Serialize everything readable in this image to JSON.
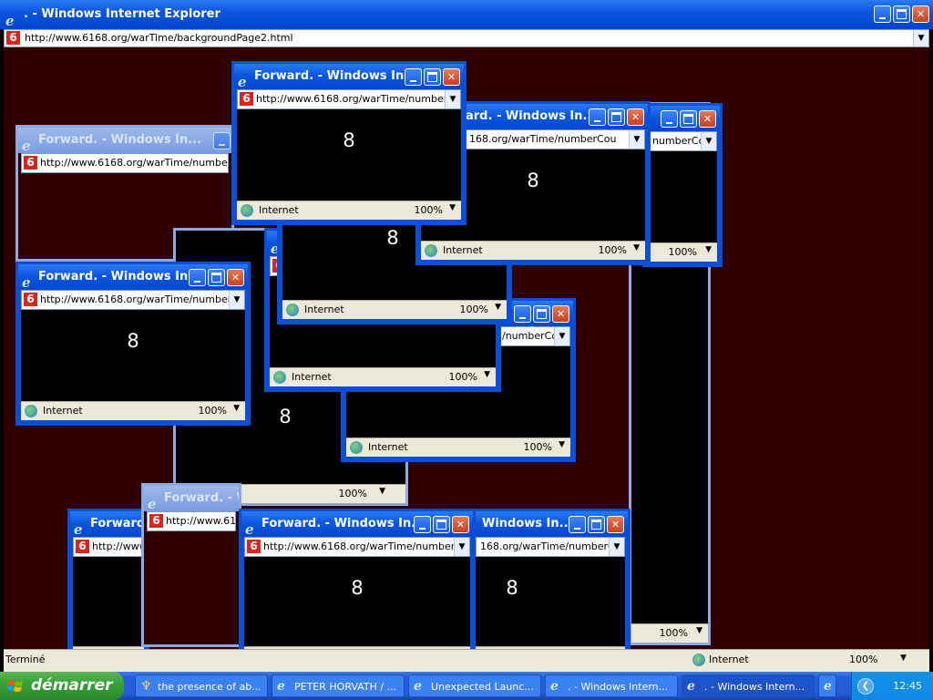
{
  "main": {
    "title": ". - Windows Internet Explorer",
    "address": "http://www.6168.org/warTime/backgroundPage2.html",
    "status": "Terminé",
    "zone": "Internet",
    "zoom": "100%"
  },
  "popup": {
    "title": "Forward. - Windows In...",
    "title_tail": "Windows In...",
    "title_frag": "Forward. - W",
    "title_frag2": "Forward.",
    "title_frag3": "ard. - Windows In...",
    "address": "http://www.6168.org/warTime/numberCou",
    "address_frag": "http://www",
    "address_frag2": "http://www.61",
    "address_frag3": "168.org/warTime/numberCou",
    "address_frag4": "numberCou",
    "address_frag5": "/numberCou",
    "address_frag6": "6",
    "number": "8",
    "zone": "Internet",
    "zoom": "100%"
  },
  "taskbar": {
    "start": "démarrer",
    "items": [
      "the presence of ab...",
      "PETER HORVATH / ...",
      "Unexpected Launc...",
      ". - Windows Intern...",
      ". - Windows Intern..."
    ],
    "clock": "12:45"
  }
}
